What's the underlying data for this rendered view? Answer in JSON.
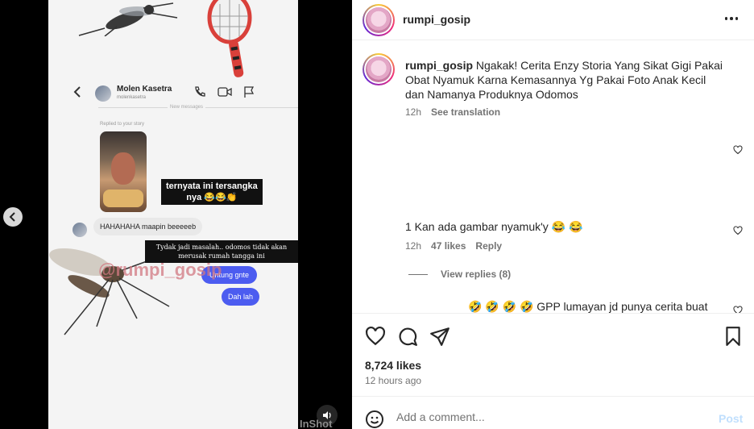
{
  "video": {
    "dm": {
      "name": "Molen Kasetra",
      "username": "molenkasetra",
      "new_messages": "New messages",
      "replied_story": "Replied to your story"
    },
    "caption1_line1": "ternyata ini tersangka",
    "caption1_line2": "nya 😂😂👏",
    "gray_message": "HAHAHAHA maapin beeeeeb",
    "caption2": "Tydak jadi masalah.. odomos tidak akan merusak rumah tangga ini",
    "blue_message1": "Untung gnte",
    "blue_message2": "Dah lah",
    "watermark": "@rumpi_gosip",
    "corner_watermark": "InShot"
  },
  "post": {
    "username": "rumpi_gosip",
    "caption_username": "rumpi_gosip",
    "caption_text": "Ngakak! Cerita Enzy Storia Yang Sikat Gigi Pakai Obat Nyamuk Karna Kemasannya Yg Pakai Foto Anak Kecil dan Namanya Produknya Odomos",
    "caption_time": "12h",
    "see_translation": "See translation",
    "comments": [
      {
        "text": "1 Kan ada gambar nyamuk'y 😂 😂",
        "time": "12h",
        "likes": "47 likes",
        "reply": "Reply",
        "view_replies": "View replies (8)"
      },
      {
        "text": "🤣 🤣 🤣 🤣  GPP lumayan jd punya cerita buat"
      }
    ],
    "likes": "8,724 likes",
    "time_ago": "12 hours ago",
    "add_comment_placeholder": "Add a comment...",
    "post_label": "Post"
  },
  "icons": {
    "prev": "chevron-left-icon",
    "mute": "speaker-icon",
    "more": "more-horizontal-icon",
    "like": "heart-icon",
    "comment": "comment-icon",
    "share": "send-icon",
    "save": "bookmark-icon",
    "emoji": "smiley-icon"
  },
  "colors": {
    "accent_blue": "#4c5cf0",
    "post_disabled": "#c0dffd",
    "muted_text": "#737373"
  }
}
